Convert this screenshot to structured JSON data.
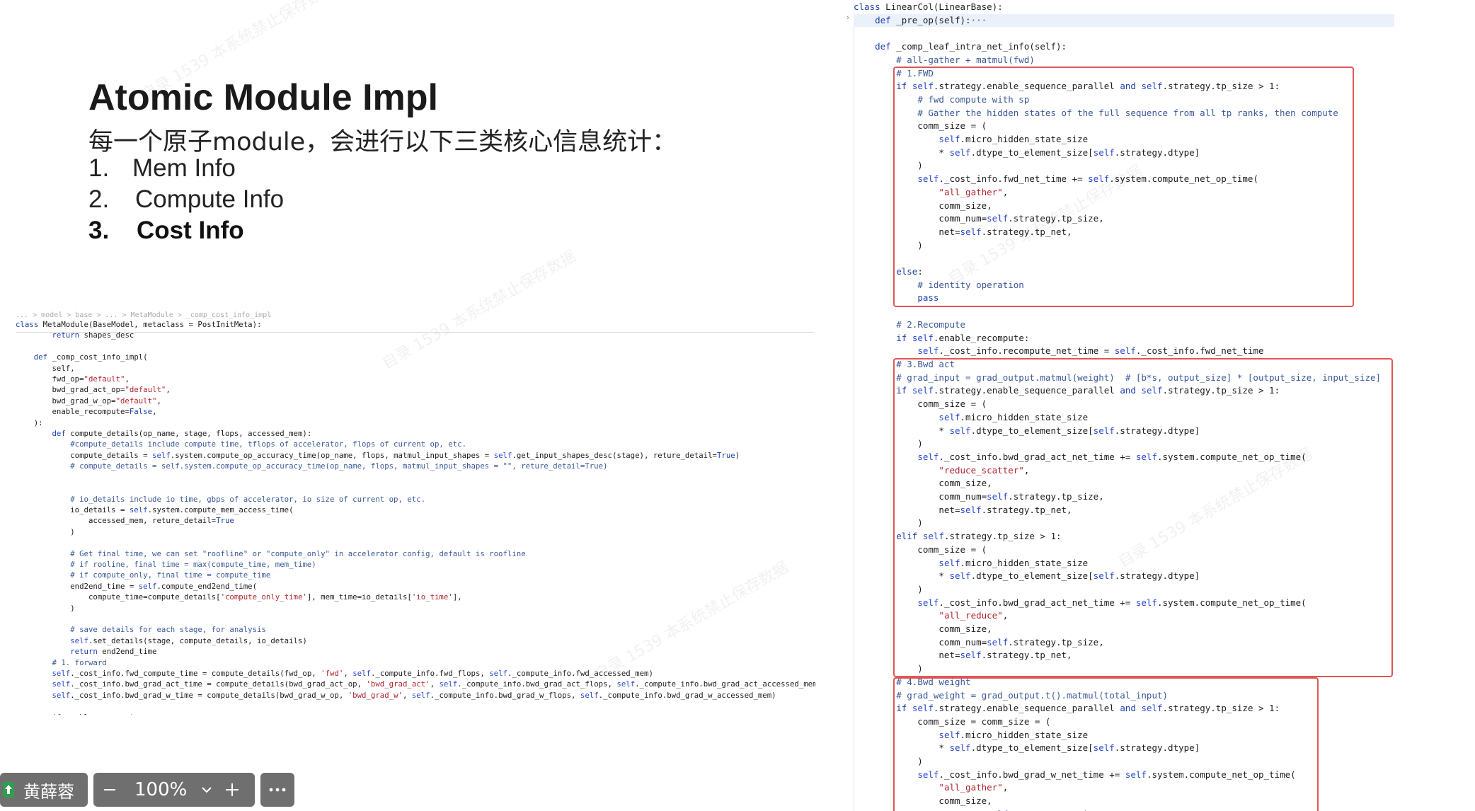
{
  "slide": {
    "title": "Atomic Module Impl",
    "subtitle": "每一个原子module，会进行以下三类核心信息统计：",
    "points": [
      {
        "num": "1.",
        "text": "Mem Info"
      },
      {
        "num": "2.",
        "text": "Compute Info"
      },
      {
        "num": "3.",
        "text": "Cost Info"
      }
    ]
  },
  "watermark": "自录 1539 本系统禁止保存数据",
  "left_code": {
    "breadcrumb": "... > model > base > ... > MetaModule > _comp_cost_info_impl",
    "lines": [
      [
        {
          "t": "class",
          "c": "kw"
        },
        {
          "t": " MetaModule(BaseModel, metaclass = PostInitMeta):"
        }
      ],
      [
        {
          "t": "        "
        },
        {
          "t": "return",
          "c": "kw"
        },
        {
          "t": " shapes_desc"
        }
      ],
      [],
      [
        {
          "t": "    "
        },
        {
          "t": "def",
          "c": "kw"
        },
        {
          "t": " _comp_cost_info_impl("
        }
      ],
      [
        {
          "t": "        self,"
        }
      ],
      [
        {
          "t": "        fwd_op="
        },
        {
          "t": "\"default\"",
          "c": "str"
        },
        {
          "t": ","
        }
      ],
      [
        {
          "t": "        bwd_grad_act_op="
        },
        {
          "t": "\"default\"",
          "c": "str"
        },
        {
          "t": ","
        }
      ],
      [
        {
          "t": "        bwd_grad_w_op="
        },
        {
          "t": "\"default\"",
          "c": "str"
        },
        {
          "t": ","
        }
      ],
      [
        {
          "t": "        enable_recompute="
        },
        {
          "t": "False",
          "c": "kw"
        },
        {
          "t": ","
        }
      ],
      [
        {
          "t": "    ):"
        }
      ],
      [
        {
          "t": "        "
        },
        {
          "t": "def",
          "c": "kw"
        },
        {
          "t": " compute_details(op_name, stage, flops, accessed_mem):"
        }
      ],
      [
        {
          "t": "            "
        },
        {
          "t": "#compute_details include compute time, tflops of accelerator, flops of current op, etc.",
          "c": "cm"
        }
      ],
      [
        {
          "t": "            compute_details = "
        },
        {
          "t": "self",
          "c": "slf"
        },
        {
          "t": ".system.compute_op_accuracy_time(op_name, flops, matmul_input_shapes = "
        },
        {
          "t": "self",
          "c": "slf"
        },
        {
          "t": ".get_input_shapes_desc(stage), reture_detail="
        },
        {
          "t": "True",
          "c": "kw"
        },
        {
          "t": ")"
        }
      ],
      [
        {
          "t": "            "
        },
        {
          "t": "# compute_details = self.system.compute_op_accuracy_time(op_name, flops, matmul_input_shapes = \"\", reture_detail=True)",
          "c": "cm"
        }
      ],
      [],
      [],
      [
        {
          "t": "            "
        },
        {
          "t": "# io_details include io time, gbps of accelerator, io size of current op, etc.",
          "c": "cm"
        }
      ],
      [
        {
          "t": "            io_details = "
        },
        {
          "t": "self",
          "c": "slf"
        },
        {
          "t": ".system.compute_mem_access_time("
        }
      ],
      [
        {
          "t": "                accessed_mem, reture_detail="
        },
        {
          "t": "True",
          "c": "kw"
        }
      ],
      [
        {
          "t": "            )"
        }
      ],
      [],
      [
        {
          "t": "            "
        },
        {
          "t": "# Get final time, we can set \"roofline\" or \"compute_only\" in accelerator config, default is roofline",
          "c": "cm"
        }
      ],
      [
        {
          "t": "            "
        },
        {
          "t": "# if rooline, final time = max(compute_time, mem_time)",
          "c": "cm"
        }
      ],
      [
        {
          "t": "            "
        },
        {
          "t": "# if compute_only, final time = compute_time",
          "c": "cm"
        }
      ],
      [
        {
          "t": "            end2end_time = "
        },
        {
          "t": "self",
          "c": "slf"
        },
        {
          "t": ".compute_end2end_time("
        }
      ],
      [
        {
          "t": "                compute_time=compute_details["
        },
        {
          "t": "'compute_only_time'",
          "c": "str"
        },
        {
          "t": "], mem_time=io_details["
        },
        {
          "t": "'io_time'",
          "c": "str"
        },
        {
          "t": "],"
        }
      ],
      [
        {
          "t": "            )"
        }
      ],
      [],
      [
        {
          "t": "            "
        },
        {
          "t": "# save details for each stage, for analysis",
          "c": "cm"
        }
      ],
      [
        {
          "t": "            "
        },
        {
          "t": "self",
          "c": "slf"
        },
        {
          "t": ".set_details(stage, compute_details, io_details)"
        }
      ],
      [
        {
          "t": "            "
        },
        {
          "t": "return",
          "c": "kw"
        },
        {
          "t": " end2end_time"
        }
      ],
      [
        {
          "t": "        "
        },
        {
          "t": "# 1. forward",
          "c": "cm"
        }
      ],
      [
        {
          "t": "        "
        },
        {
          "t": "self",
          "c": "slf"
        },
        {
          "t": "._cost_info.fwd_compute_time = compute_details(fwd_op, "
        },
        {
          "t": "'fwd'",
          "c": "str"
        },
        {
          "t": ", "
        },
        {
          "t": "self",
          "c": "slf"
        },
        {
          "t": "._compute_info.fwd_flops, "
        },
        {
          "t": "self",
          "c": "slf"
        },
        {
          "t": "._compute_info.fwd_accessed_mem)"
        }
      ],
      [
        {
          "t": "        "
        },
        {
          "t": "self",
          "c": "slf"
        },
        {
          "t": "._cost_info.bwd_grad_act_time = compute_details(bwd_grad_act_op, "
        },
        {
          "t": "'bwd_grad_act'",
          "c": "str"
        },
        {
          "t": ", "
        },
        {
          "t": "self",
          "c": "slf"
        },
        {
          "t": "._compute_info.bwd_grad_act_flops, "
        },
        {
          "t": "self",
          "c": "slf"
        },
        {
          "t": "._compute_info.bwd_grad_act_accessed_mem)"
        }
      ],
      [
        {
          "t": "        "
        },
        {
          "t": "self",
          "c": "slf"
        },
        {
          "t": "._cost_info.bwd_grad_w_time = compute_details(bwd_grad_w_op, "
        },
        {
          "t": "'bwd_grad_w'",
          "c": "str"
        },
        {
          "t": ", "
        },
        {
          "t": "self",
          "c": "slf"
        },
        {
          "t": "._compute_info.bwd_grad_w_flops, "
        },
        {
          "t": "self",
          "c": "slf"
        },
        {
          "t": "._compute_info.bwd_grad_w_accessed_mem)"
        }
      ],
      [],
      [
        {
          "t": "        "
        },
        {
          "t": "if",
          "c": "kw"
        },
        {
          "t": " enable_recompute:"
        }
      ]
    ]
  },
  "right_code": {
    "lines": [
      [
        {
          "t": "class",
          "c": "kw"
        },
        {
          "t": " LinearCol(LinearBase):"
        }
      ],
      [
        {
          "t": "    "
        },
        {
          "t": "def",
          "c": "kw"
        },
        {
          "t": " _pre_op(self):"
        },
        {
          "t": "···",
          "c": "cm"
        }
      ],
      [],
      [
        {
          "t": "    "
        },
        {
          "t": "def",
          "c": "kw"
        },
        {
          "t": " _comp_leaf_intra_net_info(self):"
        }
      ],
      [
        {
          "t": "        "
        },
        {
          "t": "# all-gather + matmul(fwd)",
          "c": "cm"
        }
      ],
      [
        {
          "t": "        "
        },
        {
          "t": "# 1.FWD",
          "c": "cm"
        }
      ],
      [
        {
          "t": "        "
        },
        {
          "t": "if",
          "c": "kw"
        },
        {
          "t": " "
        },
        {
          "t": "self",
          "c": "slf"
        },
        {
          "t": ".strategy.enable_sequence_parallel "
        },
        {
          "t": "and",
          "c": "kw"
        },
        {
          "t": " "
        },
        {
          "t": "self",
          "c": "slf"
        },
        {
          "t": ".strategy.tp_size > 1:"
        }
      ],
      [
        {
          "t": "            "
        },
        {
          "t": "# fwd compute with sp",
          "c": "cm"
        }
      ],
      [
        {
          "t": "            "
        },
        {
          "t": "# Gather the hidden states of the full sequence from all tp ranks, then compute",
          "c": "cm"
        }
      ],
      [
        {
          "t": "            comm_size = ("
        }
      ],
      [
        {
          "t": "                "
        },
        {
          "t": "self",
          "c": "slf"
        },
        {
          "t": ".micro_hidden_state_size"
        }
      ],
      [
        {
          "t": "                * "
        },
        {
          "t": "self",
          "c": "slf"
        },
        {
          "t": ".dtype_to_element_size["
        },
        {
          "t": "self",
          "c": "slf"
        },
        {
          "t": ".strategy.dtype]"
        }
      ],
      [
        {
          "t": "            )"
        }
      ],
      [
        {
          "t": "            "
        },
        {
          "t": "self",
          "c": "slf"
        },
        {
          "t": "._cost_info.fwd_net_time += "
        },
        {
          "t": "self",
          "c": "slf"
        },
        {
          "t": ".system.compute_net_op_time("
        }
      ],
      [
        {
          "t": "                "
        },
        {
          "t": "\"all_gather\"",
          "c": "str"
        },
        {
          "t": ","
        }
      ],
      [
        {
          "t": "                comm_size,"
        }
      ],
      [
        {
          "t": "                comm_num="
        },
        {
          "t": "self",
          "c": "slf"
        },
        {
          "t": ".strategy.tp_size,"
        }
      ],
      [
        {
          "t": "                net="
        },
        {
          "t": "self",
          "c": "slf"
        },
        {
          "t": ".strategy.tp_net,"
        }
      ],
      [
        {
          "t": "            )"
        }
      ],
      [],
      [
        {
          "t": "        "
        },
        {
          "t": "else",
          "c": "kw"
        },
        {
          "t": ":"
        }
      ],
      [
        {
          "t": "            "
        },
        {
          "t": "# identity operation",
          "c": "cm"
        }
      ],
      [
        {
          "t": "            "
        },
        {
          "t": "pass",
          "c": "kw"
        }
      ],
      [],
      [
        {
          "t": "        "
        },
        {
          "t": "# 2.Recompute",
          "c": "cm"
        }
      ],
      [
        {
          "t": "        "
        },
        {
          "t": "if",
          "c": "kw"
        },
        {
          "t": " "
        },
        {
          "t": "self",
          "c": "slf"
        },
        {
          "t": ".enable_recompute:"
        }
      ],
      [
        {
          "t": "            "
        },
        {
          "t": "self",
          "c": "slf"
        },
        {
          "t": "._cost_info.recompute_net_time = "
        },
        {
          "t": "self",
          "c": "slf"
        },
        {
          "t": "._cost_info.fwd_net_time"
        }
      ],
      [
        {
          "t": "        "
        },
        {
          "t": "# 3.Bwd act",
          "c": "cm"
        }
      ],
      [
        {
          "t": "        "
        },
        {
          "t": "# grad_input = grad_output.matmul(weight)  # [b*s, output_size] * [output_size, input_size]",
          "c": "cm"
        }
      ],
      [
        {
          "t": "        "
        },
        {
          "t": "if",
          "c": "kw"
        },
        {
          "t": " "
        },
        {
          "t": "self",
          "c": "slf"
        },
        {
          "t": ".strategy.enable_sequence_parallel "
        },
        {
          "t": "and",
          "c": "kw"
        },
        {
          "t": " "
        },
        {
          "t": "self",
          "c": "slf"
        },
        {
          "t": ".strategy.tp_size > 1:"
        }
      ],
      [
        {
          "t": "            comm_size = ("
        }
      ],
      [
        {
          "t": "                "
        },
        {
          "t": "self",
          "c": "slf"
        },
        {
          "t": ".micro_hidden_state_size"
        }
      ],
      [
        {
          "t": "                * "
        },
        {
          "t": "self",
          "c": "slf"
        },
        {
          "t": ".dtype_to_element_size["
        },
        {
          "t": "self",
          "c": "slf"
        },
        {
          "t": ".strategy.dtype]"
        }
      ],
      [
        {
          "t": "            )"
        }
      ],
      [
        {
          "t": "            "
        },
        {
          "t": "self",
          "c": "slf"
        },
        {
          "t": "._cost_info.bwd_grad_act_net_time += "
        },
        {
          "t": "self",
          "c": "slf"
        },
        {
          "t": ".system.compute_net_op_time("
        }
      ],
      [
        {
          "t": "                "
        },
        {
          "t": "\"reduce_scatter\"",
          "c": "str"
        },
        {
          "t": ","
        }
      ],
      [
        {
          "t": "                comm_size,"
        }
      ],
      [
        {
          "t": "                comm_num="
        },
        {
          "t": "self",
          "c": "slf"
        },
        {
          "t": ".strategy.tp_size,"
        }
      ],
      [
        {
          "t": "                net="
        },
        {
          "t": "self",
          "c": "slf"
        },
        {
          "t": ".strategy.tp_net,"
        }
      ],
      [
        {
          "t": "            )"
        }
      ],
      [
        {
          "t": "        "
        },
        {
          "t": "elif",
          "c": "kw"
        },
        {
          "t": " "
        },
        {
          "t": "self",
          "c": "slf"
        },
        {
          "t": ".strategy.tp_size > 1:"
        }
      ],
      [
        {
          "t": "            comm_size = ("
        }
      ],
      [
        {
          "t": "                "
        },
        {
          "t": "self",
          "c": "slf"
        },
        {
          "t": ".micro_hidden_state_size"
        }
      ],
      [
        {
          "t": "                * "
        },
        {
          "t": "self",
          "c": "slf"
        },
        {
          "t": ".dtype_to_element_size["
        },
        {
          "t": "self",
          "c": "slf"
        },
        {
          "t": ".strategy.dtype]"
        }
      ],
      [
        {
          "t": "            )"
        }
      ],
      [
        {
          "t": "            "
        },
        {
          "t": "self",
          "c": "slf"
        },
        {
          "t": "._cost_info.bwd_grad_act_net_time += "
        },
        {
          "t": "self",
          "c": "slf"
        },
        {
          "t": ".system.compute_net_op_time("
        }
      ],
      [
        {
          "t": "                "
        },
        {
          "t": "\"all_reduce\"",
          "c": "str"
        },
        {
          "t": ","
        }
      ],
      [
        {
          "t": "                comm_size,"
        }
      ],
      [
        {
          "t": "                comm_num="
        },
        {
          "t": "self",
          "c": "slf"
        },
        {
          "t": ".strategy.tp_size,"
        }
      ],
      [
        {
          "t": "                net="
        },
        {
          "t": "self",
          "c": "slf"
        },
        {
          "t": ".strategy.tp_net,"
        }
      ],
      [
        {
          "t": "            )"
        }
      ],
      [
        {
          "t": "        "
        },
        {
          "t": "# 4.Bwd weight",
          "c": "cm"
        }
      ],
      [
        {
          "t": "        "
        },
        {
          "t": "# grad_weight = grad_output.t().matmul(total_input)",
          "c": "cm"
        }
      ],
      [
        {
          "t": "        "
        },
        {
          "t": "if",
          "c": "kw"
        },
        {
          "t": " "
        },
        {
          "t": "self",
          "c": "slf"
        },
        {
          "t": ".strategy.enable_sequence_parallel "
        },
        {
          "t": "and",
          "c": "kw"
        },
        {
          "t": " "
        },
        {
          "t": "self",
          "c": "slf"
        },
        {
          "t": ".strategy.tp_size > 1:"
        }
      ],
      [
        {
          "t": "            comm_size = comm_size = ("
        }
      ],
      [
        {
          "t": "                "
        },
        {
          "t": "self",
          "c": "slf"
        },
        {
          "t": ".micro_hidden_state_size"
        }
      ],
      [
        {
          "t": "                * "
        },
        {
          "t": "self",
          "c": "slf"
        },
        {
          "t": ".dtype_to_element_size["
        },
        {
          "t": "self",
          "c": "slf"
        },
        {
          "t": ".strategy.dtype]"
        }
      ],
      [
        {
          "t": "            )"
        }
      ],
      [
        {
          "t": "            "
        },
        {
          "t": "self",
          "c": "slf"
        },
        {
          "t": "._cost_info.bwd_grad_w_net_time += "
        },
        {
          "t": "self",
          "c": "slf"
        },
        {
          "t": ".system.compute_net_op_time("
        }
      ],
      [
        {
          "t": "                "
        },
        {
          "t": "\"all_gather\"",
          "c": "str"
        },
        {
          "t": ","
        }
      ],
      [
        {
          "t": "                comm_size,"
        }
      ],
      [
        {
          "t": "                comm_num="
        },
        {
          "t": "self",
          "c": "slf"
        },
        {
          "t": ".strategy.tp_size,"
        }
      ]
    ]
  },
  "toolbar": {
    "user_name": "黄薛蓉",
    "zoom": "100%",
    "zoom_out_icon": "minus-icon",
    "zoom_in_icon": "plus-icon",
    "dropdown_icon": "chevron-down-icon",
    "more_icon": "more-dots-icon",
    "upload_icon": "upload-arrow-icon",
    "chip_icon_color": "#2e9e4f"
  }
}
